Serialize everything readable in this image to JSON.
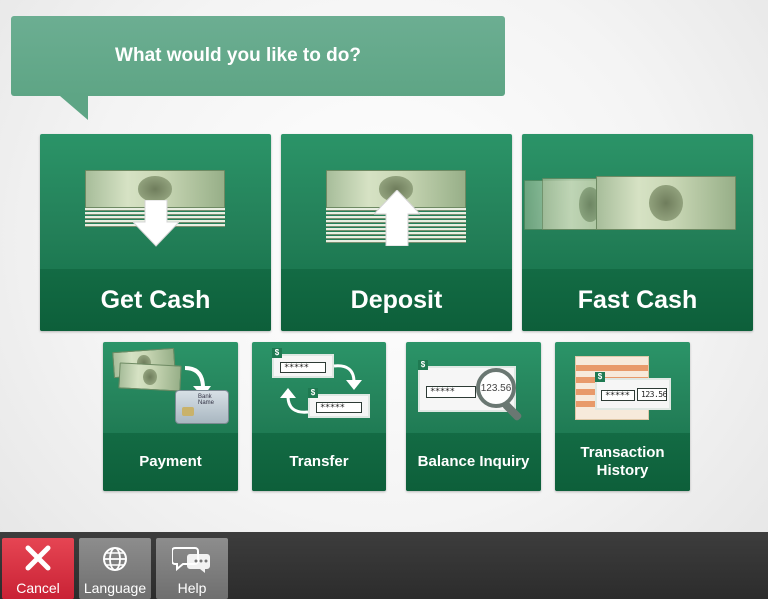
{
  "prompt": {
    "text": "What would you like to do?"
  },
  "main_options": [
    {
      "label": "Get Cash",
      "icon": "cash-down-arrow-icon"
    },
    {
      "label": "Deposit",
      "icon": "cash-up-arrow-icon"
    },
    {
      "label": "Fast Cash",
      "icon": "twenty-dollar-bills-icon"
    }
  ],
  "secondary_options": [
    {
      "label": "Payment",
      "icon": "bill-to-card-icon"
    },
    {
      "label": "Transfer",
      "icon": "transfer-arrows-icon"
    },
    {
      "label": "Balance Inquiry",
      "icon": "magnifier-balance-icon",
      "amount": "123.56"
    },
    {
      "label": "Transaction History",
      "icon": "statement-stack-icon",
      "amount": "123.56"
    }
  ],
  "masked_value": "*****",
  "card_text": "Bank Name",
  "footer": {
    "cancel_label": "Cancel",
    "language_label": "Language",
    "help_label": "Help"
  },
  "colors": {
    "tile_green": "#237f58",
    "tile_dark": "#0d5f3a",
    "prompt_bg": "#5ea585",
    "cancel_red": "#d32f3f",
    "footer_bg": "#333333"
  }
}
